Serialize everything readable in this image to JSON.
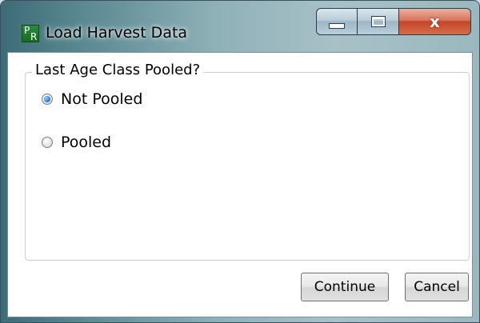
{
  "window": {
    "title": "Load Harvest Data",
    "icon_letters": {
      "top": "P",
      "bottom": "R"
    },
    "caption_buttons": {
      "minimize": "minimize-icon",
      "maximize": "maximize-icon",
      "close": "x"
    }
  },
  "group": {
    "legend": "Last Age Class Pooled?",
    "options": [
      {
        "label": "Not Pooled",
        "checked": true
      },
      {
        "label": "Pooled",
        "checked": false
      }
    ]
  },
  "buttons": {
    "continue_label": "Continue",
    "cancel_label": "Cancel"
  },
  "colors": {
    "accent_radio": "#2f7fd4",
    "close_button": "#c3452a",
    "app_icon": "#186d24"
  }
}
